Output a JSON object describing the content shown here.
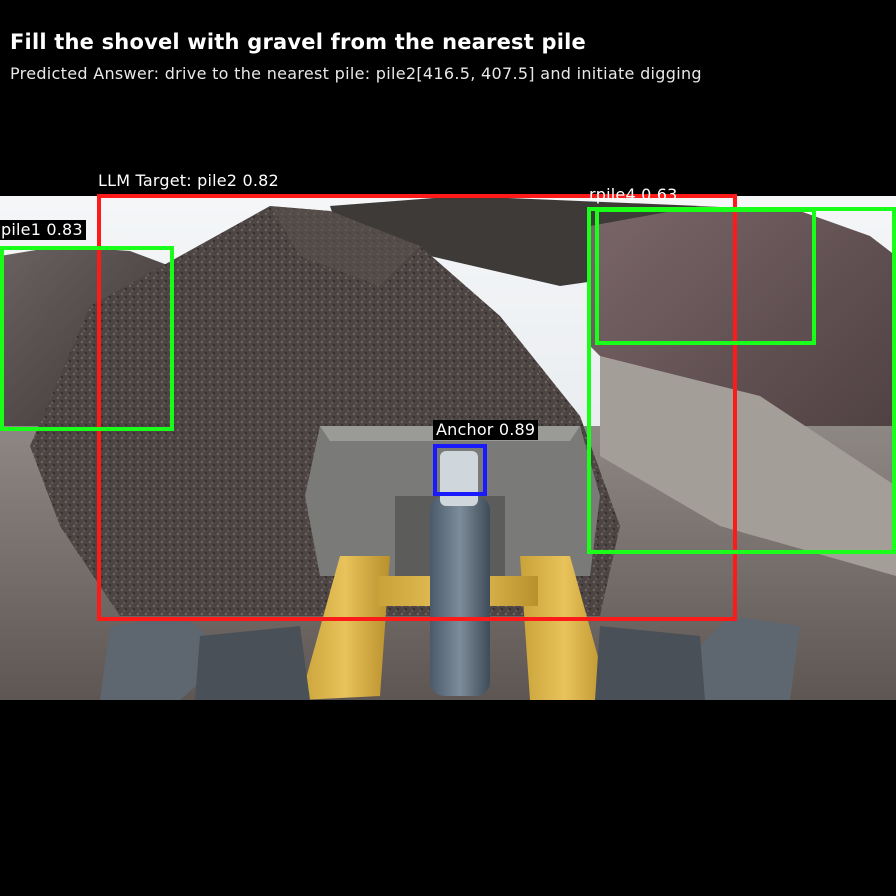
{
  "header": {
    "title": "Fill the shovel with gravel from the nearest pile",
    "predicted_answer": "Predicted Answer: drive to the nearest pile: pile2[416.5, 407.5] and initiate digging"
  },
  "detections": {
    "llm_target": {
      "label": "LLM Target: pile2 0.82",
      "color": "#ff1a1a"
    },
    "pile1": {
      "label": "pile1 0.83",
      "color": "#1aff1a"
    },
    "pile4": {
      "label": "rpile4 0.63",
      "color": "#1aff1a"
    },
    "anchor": {
      "label": "Anchor 0.89",
      "color": "#1a1aff"
    }
  }
}
